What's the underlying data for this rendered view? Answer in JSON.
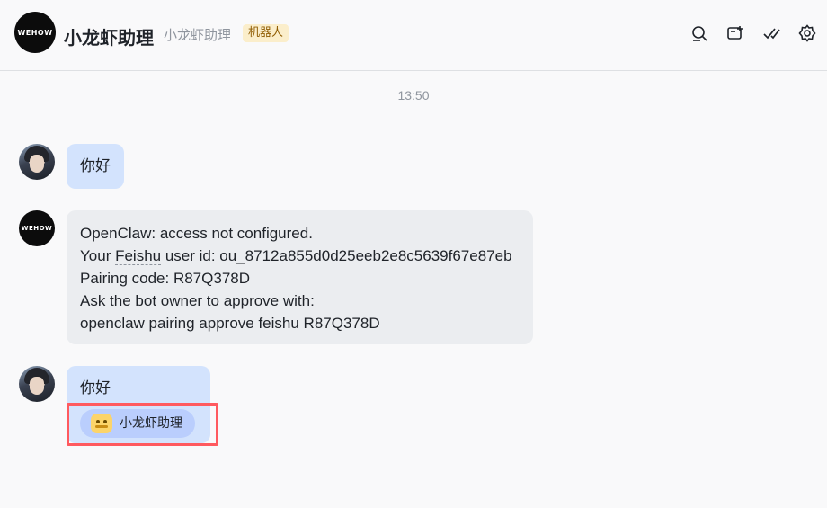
{
  "header": {
    "logo_text": "WEHOW",
    "title": "小龙虾助理",
    "subtitle": "小龙虾助理",
    "badge": "机器人",
    "icons": [
      "search-icon",
      "add-chat-icon",
      "check-done-icon",
      "settings-icon"
    ]
  },
  "chat": {
    "timestamp": "13:50",
    "messages": [
      {
        "sender": "user",
        "text": "你好"
      },
      {
        "sender": "bot",
        "avatar_text": "WEHOW",
        "lines": [
          "OpenClaw: access not configured.",
          "Your Feishu user id: ou_8712a855d0d25eeb2e8c5639f67e87eb",
          "Pairing code: R87Q378D",
          "Ask the bot owner to approve with:",
          "openclaw pairing approve feishu R87Q378D"
        ],
        "line2_prefix": "Your ",
        "line2_word": "Feishu",
        "line2_suffix": " user id: ou_8712a855d0d25eeb2e8c5639f67e87eb"
      },
      {
        "sender": "user",
        "text": "你好",
        "mention": "小龙虾助理"
      }
    ]
  },
  "colors": {
    "user_bubble": "#d3e3fd",
    "bot_bubble": "#ebedf0",
    "mention_chip": "#bacefd",
    "highlight": "#ff5a5f",
    "badge_bg": "#fbeecb"
  }
}
